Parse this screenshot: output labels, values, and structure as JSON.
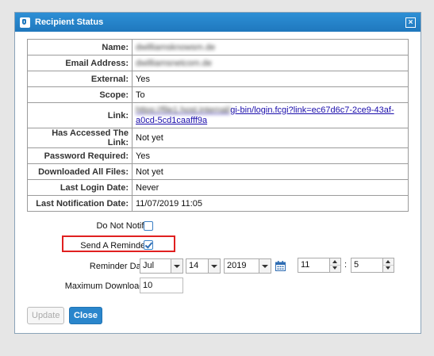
{
  "dialog": {
    "title": "Recipient Status",
    "close_symbol": "×"
  },
  "info_rows": [
    {
      "label": "Name:",
      "value": "dwilliamsknowsm.de",
      "blurred": true
    },
    {
      "label": "Email Address:",
      "value": "dwilliamsnetcom.de",
      "blurred": true
    },
    {
      "label": "External:",
      "value": "Yes"
    },
    {
      "label": "Scope:",
      "value": "To"
    },
    {
      "label": "Link:",
      "link_blurred_part": "https://file1.host.internal/",
      "link_visible_part": "gi-bin/login.fcgi?link=ec67d6c7-2ce9-43af-a0cd-5cd1caafff9a"
    },
    {
      "label": "Has Accessed The Link:",
      "value": "Not yet"
    },
    {
      "label": "Password Required:",
      "value": "Yes"
    },
    {
      "label": "Downloaded All Files:",
      "value": "Not yet"
    },
    {
      "label": "Last Login Date:",
      "value": "Never"
    },
    {
      "label": "Last Notification Date:",
      "value": "11/07/2019 11:05"
    }
  ],
  "form": {
    "do_not_notify": {
      "label": "Do Not Notify :",
      "checked": false
    },
    "send_reminder": {
      "label": "Send A Reminder :",
      "checked": true
    },
    "reminder_date": {
      "label": "Reminder Date :",
      "month": "Jul",
      "day": "14",
      "year": "2019",
      "hour": "11",
      "minute": "5",
      "time_separator": ":"
    },
    "max_downloads": {
      "label": "Maximum Downloads :",
      "value": "10"
    }
  },
  "buttons": {
    "update_label": "Update",
    "close_label": "Close"
  },
  "colors": {
    "titlebar": "#1f78bd",
    "highlight": "#e02020",
    "primary_button": "#2a86cc"
  },
  "icons": {
    "title": "app-logo-icon",
    "close": "close-icon",
    "calendar": "calendar-icon"
  }
}
